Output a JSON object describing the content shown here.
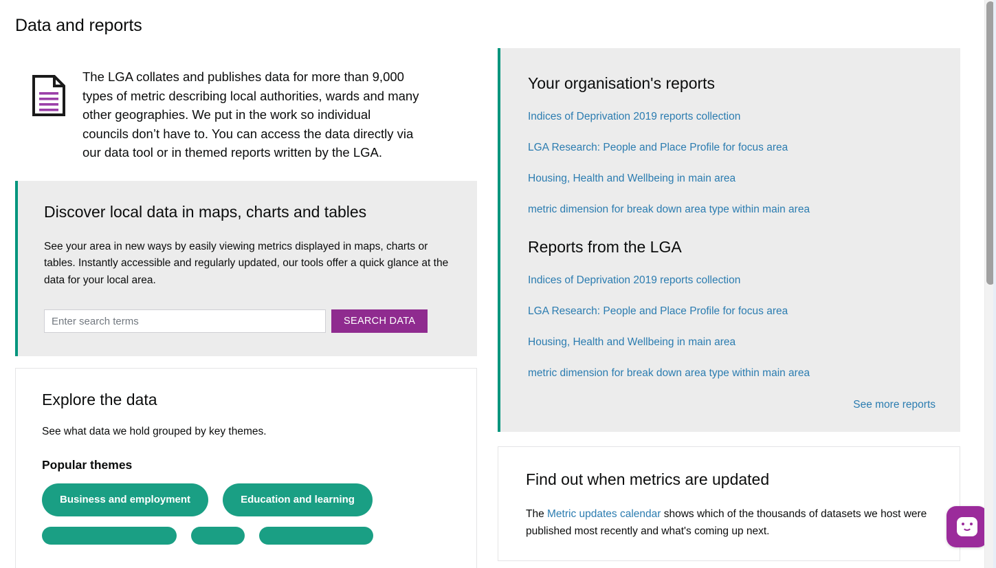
{
  "page": {
    "title": "Data and reports"
  },
  "intro": {
    "icon": "document-lines-icon",
    "text": "The LGA collates and publishes data for more than 9,000 types of metric describing local authorities, wards and many other geographies. We put in the work so individual councils don’t have to. You can access the data directly via our data tool or in themed reports written by the LGA."
  },
  "discover": {
    "heading": "Discover local data in maps, charts and tables",
    "body": "See your area in new ways by easily viewing metrics displayed in maps, charts or tables. Instantly accessible and regularly updated, our tools offer a quick glance at the data for your local area.",
    "search_placeholder": "Enter search terms",
    "search_value": "",
    "search_button": "SEARCH DATA"
  },
  "explore": {
    "heading": "Explore the data",
    "body": "See what data we hold grouped by key themes.",
    "subheading": "Popular themes",
    "themes_row1": [
      "Business and employment",
      "Education and learning"
    ],
    "themes_row2": [
      "",
      "",
      ""
    ]
  },
  "org_reports": {
    "heading": "Your organisation's reports",
    "links": [
      "Indices of Deprivation 2019 reports collection",
      "LGA Research: People and Place Profile for focus area",
      "Housing, Health and Wellbeing in main area",
      "metric dimension for break down area type within main area"
    ]
  },
  "lga_reports": {
    "heading": "Reports from the LGA",
    "links": [
      "Indices of Deprivation 2019 reports collection",
      "LGA Research: People and Place Profile for focus area",
      "Housing, Health and Wellbeing in main area",
      "metric dimension for break down area type within main area"
    ],
    "see_more": "See more reports"
  },
  "metrics_updated": {
    "heading": "Find out when metrics are updated",
    "text_before": "The ",
    "link": "Metric updates calendar",
    "text_after": " shows which of the thousands of datasets we host were published most recently and what's coming up next."
  },
  "chat": {
    "icon": "chat-smiley-icon"
  },
  "colors": {
    "accent_teal": "#00957d",
    "pill_teal": "#1a9f84",
    "purple": "#8f2b8f",
    "chat_purple": "#9b2b9b",
    "link_blue": "#2b7cb0",
    "panel_grey": "#ececec"
  }
}
